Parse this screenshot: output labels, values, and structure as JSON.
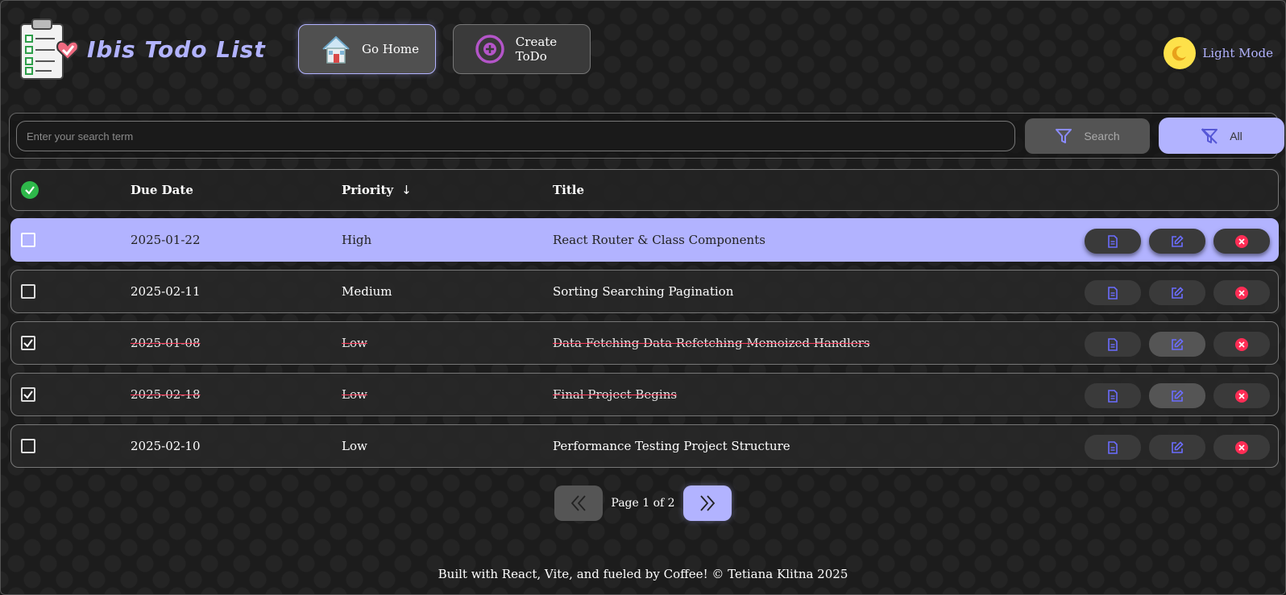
{
  "app": {
    "title": "Ibis Todo List",
    "accent": "#b2b3ff",
    "danger": "#ff2d55"
  },
  "nav": {
    "home_label": "Go Home",
    "home_icon": "house-icon",
    "create_label": "Create ToDo",
    "create_icon": "plus-circle-icon",
    "mode_label": "Light Mode",
    "mode_icon": "moon-icon"
  },
  "search": {
    "placeholder": "Enter your search term",
    "value": "",
    "search_label": "Search",
    "all_label": "All"
  },
  "table": {
    "headers": {
      "due_date": "Due Date",
      "priority": "Priority",
      "title": "Title",
      "sort_indicator": "↓"
    },
    "rows": [
      {
        "due_date": "2025-01-22",
        "priority": "High",
        "title": "React Router & Class Components",
        "completed": false,
        "selected": true
      },
      {
        "due_date": "2025-02-11",
        "priority": "Medium",
        "title": "Sorting Searching Pagination",
        "completed": false,
        "selected": false
      },
      {
        "due_date": "2025-01-08",
        "priority": "Low",
        "title": "Data Fetching Data Refetching Memoized Handlers",
        "completed": true,
        "selected": false
      },
      {
        "due_date": "2025-02-18",
        "priority": "Low",
        "title": "Final Project Begins",
        "completed": true,
        "selected": false
      },
      {
        "due_date": "2025-02-10",
        "priority": "Low",
        "title": "Performance Testing Project Structure",
        "completed": false,
        "selected": false
      }
    ]
  },
  "pagination": {
    "text": "Page 1 of 2",
    "current": 1,
    "total": 2
  },
  "footer": {
    "text": "Built with React, Vite, and fueled by Coffee! © Tetiana Klitna 2025"
  }
}
